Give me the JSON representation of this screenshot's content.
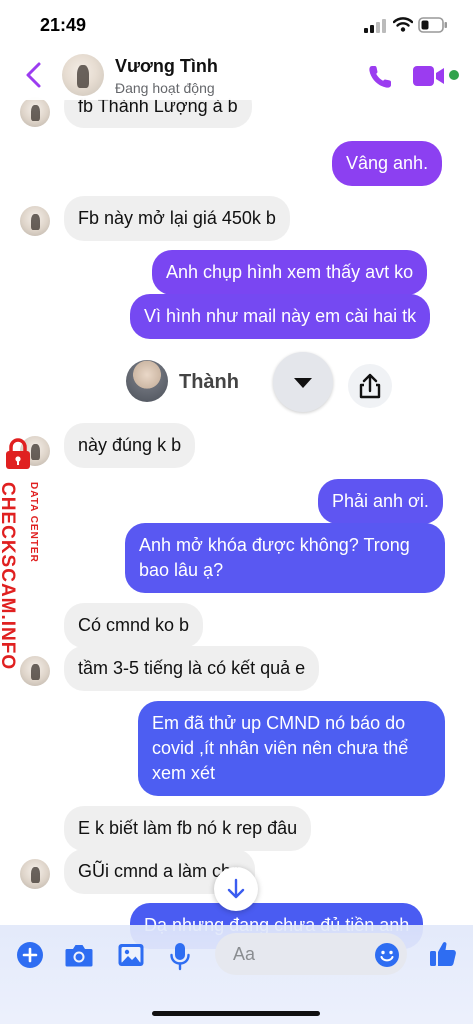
{
  "status_bar": {
    "time": "21:49"
  },
  "header": {
    "contact_name": "Vương Tình",
    "presence": "Đang hoạt động"
  },
  "messages": [
    {
      "dir": "in",
      "text": "fb  Thành Lượng à b"
    },
    {
      "dir": "out",
      "text": "Vâng anh."
    },
    {
      "dir": "in",
      "text": "Fb này mở lại giá 450k b"
    },
    {
      "dir": "out",
      "text": "Anh chụp hình xem thấy avt ko"
    },
    {
      "dir": "out",
      "text": "Vì hình như mail này em cài hai tk"
    },
    {
      "dir": "in",
      "text": "này đúng k b"
    },
    {
      "dir": "out",
      "text": "Phải anh ơi."
    },
    {
      "dir": "out",
      "text": "Anh mở khóa được không? Trong\nbao lâu ạ?"
    },
    {
      "dir": "in",
      "text": "Có cmnd ko b"
    },
    {
      "dir": "in",
      "text": "tầm 3-5 tiếng là có kết quả e"
    },
    {
      "dir": "out",
      "text": "Em đã thử up CMND nó báo do\ncovid ,ít nhân viên nên chưa thể\nxem xét"
    },
    {
      "dir": "in",
      "text": "E k biết làm fb nó k rep đâu"
    },
    {
      "dir": "in",
      "text": "GŨi cmnd a làm cho"
    },
    {
      "dir": "out",
      "text": "Dạ nhưng đang chưa đủ tiền anh"
    }
  ],
  "shared_contact": {
    "name": "Thành"
  },
  "watermark": {
    "main": "CHECKSCAM.INFO",
    "sub": "DATA CENTER"
  },
  "composer": {
    "placeholder": "Aa"
  },
  "colors": {
    "accent": "#9b3cf0",
    "bubble_out_top": "#8f3df2",
    "bubble_out_bottom": "#4a5cf2",
    "incoming": "#efefef"
  }
}
